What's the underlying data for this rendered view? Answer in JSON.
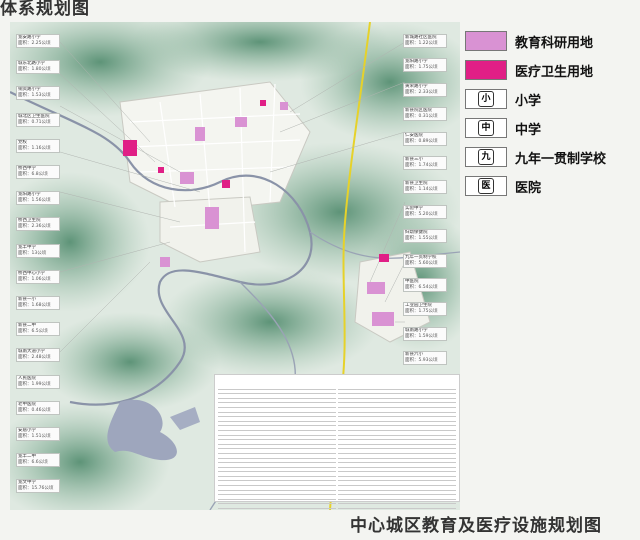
{
  "top_title": "体系规划图",
  "caption": "中心城区教育及医疗设施规划图",
  "legend": [
    {
      "label": "教育科研用地",
      "swatch": "fill",
      "color": "#d992d3"
    },
    {
      "label": "医疗卫生用地",
      "swatch": "fill",
      "color": "#e01f86"
    },
    {
      "label": "小学",
      "swatch": "glyph",
      "glyph": "小"
    },
    {
      "label": "中学",
      "swatch": "glyph",
      "glyph": "中"
    },
    {
      "label": "九年一贯制学校",
      "swatch": "glyph",
      "glyph": "九"
    },
    {
      "label": "医院",
      "swatch": "glyph",
      "glyph": "医"
    }
  ],
  "left_labels": [
    {
      "name": "宽安路小学",
      "area": "面积：2.25公顷"
    },
    {
      "name": "城东北路小学",
      "area": "面积：1.80公顷"
    },
    {
      "name": "铜资路小学",
      "area": "面积：1.53公顷"
    },
    {
      "name": "城北区卫生医院",
      "area": "面积：0.71公顷"
    },
    {
      "name": "党校",
      "area": "面积：1.16公顷"
    },
    {
      "name": "桥西中学",
      "area": "面积：6.8公顷"
    },
    {
      "name": "宽阳路小学",
      "area": "面积：1.56公顷"
    },
    {
      "name": "桥西卫生院",
      "area": "面积：2.36公顷"
    },
    {
      "name": "宽丰中学",
      "area": "面积：13公顷"
    },
    {
      "name": "桥西中心小学",
      "area": "面积：1.06公顷"
    },
    {
      "name": "新县一小",
      "area": "面积：1.68公顷"
    },
    {
      "name": "新县二中",
      "area": "面积：6.5公顷"
    },
    {
      "name": "城南大道小学",
      "area": "面积：2.48公顷"
    },
    {
      "name": "人民医院",
      "area": "面积：1.99公顷"
    },
    {
      "name": "老中医院",
      "area": "面积：0.46公顷"
    },
    {
      "name": "安居小学",
      "area": "面积：1.51公顷"
    },
    {
      "name": "宽丰二中",
      "area": "面积：6.6公顷"
    },
    {
      "name": "宽文中学",
      "area": "面积：15.76公顷"
    }
  ],
  "right_labels": [
    {
      "name": "新城路社区医院",
      "area": "面积：1.22公顷"
    },
    {
      "name": "宽阳路小学",
      "area": "面积：1.75公顷"
    },
    {
      "name": "黄荣路小学",
      "area": "面积：2.33公顷"
    },
    {
      "name": "新县院区医院",
      "area": "面积：0.31公顷"
    },
    {
      "name": "仁安医院",
      "area": "面积：0.89公顷"
    },
    {
      "name": "新县三小",
      "area": "面积：1.74公顷"
    },
    {
      "name": "新县卫生院",
      "area": "面积：1.14公顷"
    },
    {
      "name": "实验中学",
      "area": "面积：5.20公顷"
    },
    {
      "name": "妇幼保健院",
      "area": "面积：1.55公顷"
    },
    {
      "name": "九年一贯制学校",
      "area": "面积：5.60公顷"
    },
    {
      "name": "中医院",
      "area": "面积：6.54公顷"
    },
    {
      "name": "工业园卫生院",
      "area": "面积：1.75公顷"
    },
    {
      "name": "城南路小学",
      "area": "面积：1.59公顷"
    },
    {
      "name": "新县六小",
      "area": "面积：5.93公顷"
    }
  ]
}
